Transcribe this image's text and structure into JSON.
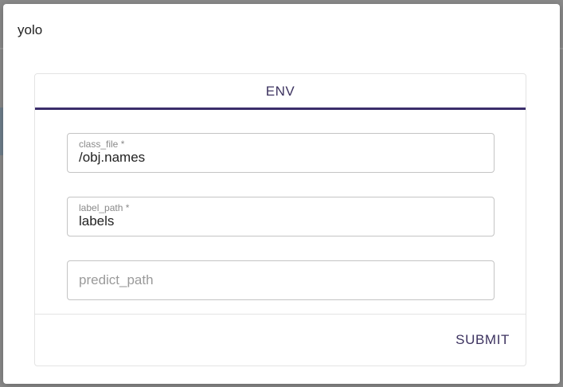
{
  "dialog": {
    "title": "yolo"
  },
  "tabs": [
    {
      "label": "ENV",
      "active": true
    }
  ],
  "form": {
    "fields": [
      {
        "label": "class_file *",
        "value": "/obj.names",
        "placeholder": ""
      },
      {
        "label": "label_path *",
        "value": "labels",
        "placeholder": ""
      },
      {
        "label": "",
        "value": "",
        "placeholder": "predict_path"
      }
    ],
    "submit_label": "SUBMIT"
  },
  "colors": {
    "accent": "#3a2d6b",
    "tab_text": "#3d3360",
    "border": "#c4c4c4"
  }
}
